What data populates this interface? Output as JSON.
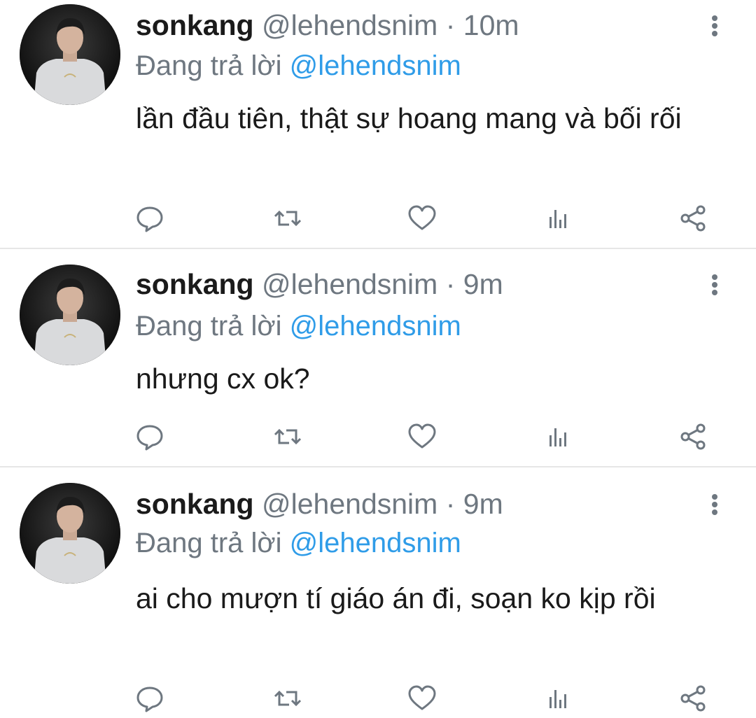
{
  "tweets": [
    {
      "display_name": "sonkang",
      "handle": "@lehendsnim",
      "separator": "·",
      "time": "10m",
      "reply_prefix": "Đang trả lời",
      "reply_to": "@lehendsnim",
      "text": "lần đầu tiên, thật sự hoang mang và bối rối"
    },
    {
      "display_name": "sonkang",
      "handle": "@lehendsnim",
      "separator": "·",
      "time": "9m",
      "reply_prefix": "Đang trả lời",
      "reply_to": "@lehendsnim",
      "text": "nhưng cx ok?"
    },
    {
      "display_name": "sonkang",
      "handle": "@lehendsnim",
      "separator": "·",
      "time": "9m",
      "reply_prefix": "Đang trả lời",
      "reply_to": "@lehendsnim",
      "text": "ai cho mượn tí giáo án đi, soạn ko kịp rồi"
    }
  ],
  "icons": {
    "reply": "reply-icon",
    "retweet": "retweet-icon",
    "like": "heart-icon",
    "stats": "analytics-icon",
    "share": "share-icon",
    "more": "more-vertical-icon"
  },
  "colors": {
    "text": "#1a1a1a",
    "secondary": "#6e7780",
    "link": "#2f9ce8",
    "divider": "#e6e6e6"
  }
}
